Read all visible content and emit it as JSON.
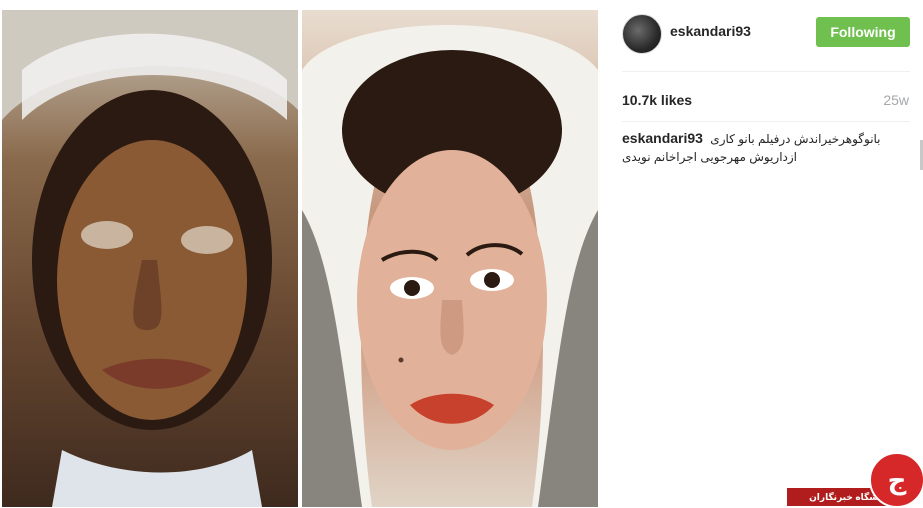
{
  "post": {
    "username": "eskandari93",
    "follow_label": "Following",
    "likes": "10.7k likes",
    "age": "25w",
    "caption_user": "eskandari93",
    "caption_line1": "بانوگوهرخیراندش درفیلم بانو کاری",
    "caption_line2": "ازداریوش مهرجویی اجراخانم نویدی"
  },
  "watermark": {
    "label": "باشگاه خبرنگاران"
  },
  "colors": {
    "follow_button": "#70c050",
    "watermark_red": "#b11d1d",
    "text_dark": "#262626",
    "text_muted": "#a5a7aa"
  }
}
